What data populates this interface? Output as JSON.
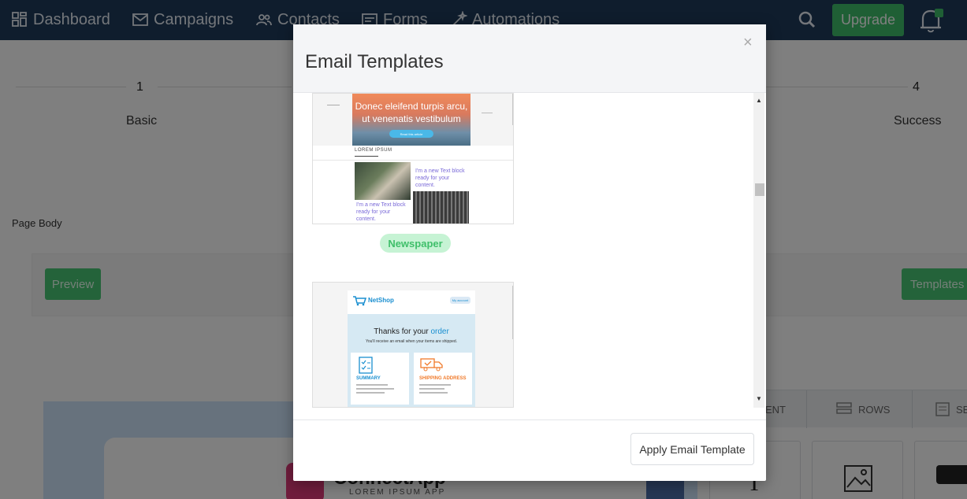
{
  "nav": {
    "items": [
      {
        "label": "Dashboard",
        "icon": "dashboard-icon"
      },
      {
        "label": "Campaigns",
        "icon": "mail-icon"
      },
      {
        "label": "Contacts",
        "icon": "contacts-icon"
      },
      {
        "label": "Forms",
        "icon": "form-icon"
      },
      {
        "label": "Automations",
        "icon": "magic-wand-icon"
      }
    ],
    "upgrade_label": "Upgrade"
  },
  "steps": [
    {
      "number": "1",
      "label": "Basic"
    },
    {
      "number": "4",
      "label": "Success"
    }
  ],
  "page_body_label": "Page Body",
  "toolbar": {
    "preview_label": "Preview",
    "templates_label": "Templates"
  },
  "editor": {
    "logo_text": "ConnectApp",
    "logo_subtitle": "LOREM IPSUM APP",
    "side_tabs": [
      {
        "label": "ENT",
        "icon": "content-icon"
      },
      {
        "label": "ROWS",
        "icon": "rows-icon"
      },
      {
        "label": "SE",
        "icon": "settings-icon"
      }
    ]
  },
  "modal": {
    "title": "Email Templates",
    "close_glyph": "×",
    "apply_label": "Apply Email Template",
    "templates": [
      {
        "name": "Newspaper",
        "hero_text": "Donec eleifend turpis arcu, ut venenatis vestibulum",
        "hero_button": "Read this article",
        "section_label": "LOREM IPSUM",
        "text_block_1": "I'm a new Text block ready for your content.",
        "text_block_2": "I'm a new Text block ready for your content."
      },
      {
        "name": "NetShop",
        "brand": "NetShop",
        "account_label": "My account",
        "headline_prefix": "Thanks for your ",
        "headline_emphasis": "order",
        "subline": "You'll receive an email when your items are shipped.",
        "summary_label": "SUMMARY",
        "shipping_label": "SHIPPING ADDRESS"
      }
    ]
  },
  "colors": {
    "nav_bg": "#1e3a5a",
    "brand_green": "#3fbf6a",
    "badge_bg": "#c6f3d4",
    "netshop_blue": "#1a8fd0",
    "netshop_orange": "#f07a2a"
  }
}
